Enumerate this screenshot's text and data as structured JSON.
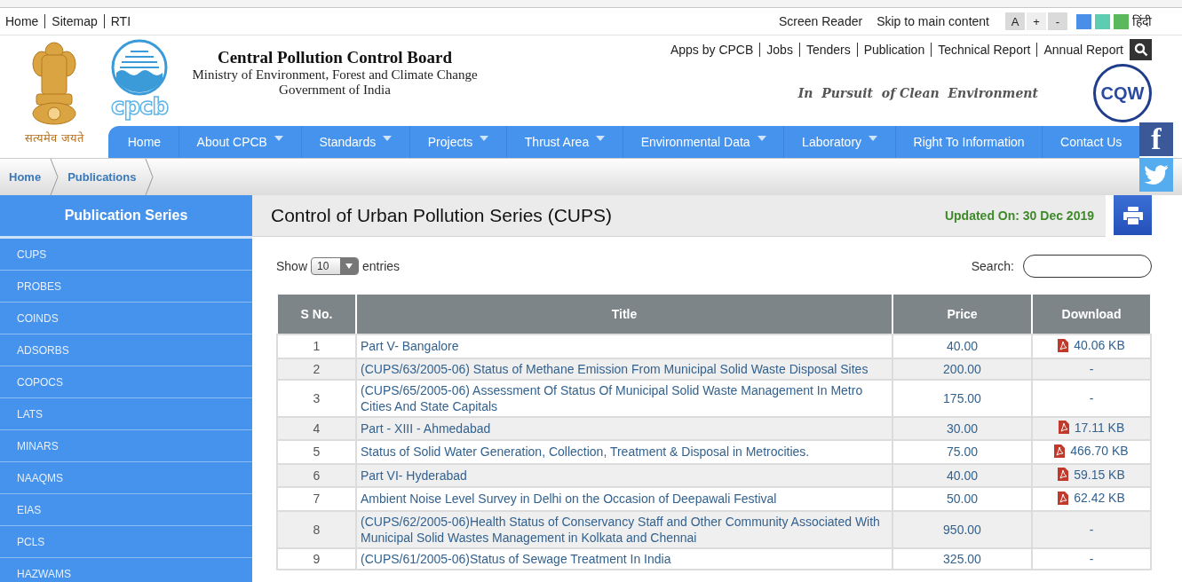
{
  "top_links": [
    {
      "label": "Home"
    },
    {
      "label": "Sitemap"
    },
    {
      "label": "RTI"
    }
  ],
  "accessibility": {
    "screen_reader": "Screen Reader",
    "skip": "Skip to main content",
    "font_buttons": [
      "A",
      "+",
      "-"
    ],
    "themes": [
      {
        "color": "#4a8fe7"
      },
      {
        "color": "#5ccdb0"
      },
      {
        "color": "#5cb85c"
      }
    ],
    "language": "हिंदी"
  },
  "header": {
    "emblem_motto": "सत्यमेव जयते",
    "logo_text": "cpcb",
    "title": "Central Pollution Control Board",
    "ministry": "Ministry of Environment, Forest and Climate Change",
    "government": "Government of India",
    "tagline": "In  Pursuit  of Clean  Environment",
    "badge_text": "CQW"
  },
  "quick_links": [
    "Apps by CPCB",
    "Jobs",
    "Tenders",
    "Publication",
    "Technical Report",
    "Annual Report"
  ],
  "nav": [
    {
      "label": "Home",
      "dropdown": false
    },
    {
      "label": "About CPCB",
      "dropdown": true
    },
    {
      "label": "Standards",
      "dropdown": true
    },
    {
      "label": "Projects",
      "dropdown": true
    },
    {
      "label": "Thrust Area",
      "dropdown": true
    },
    {
      "label": "Environmental Data",
      "dropdown": true
    },
    {
      "label": "Laboratory",
      "dropdown": true
    },
    {
      "label": "Right To Information",
      "dropdown": false
    },
    {
      "label": "Contact Us",
      "dropdown": false
    }
  ],
  "social": [
    {
      "kind": "facebook",
      "text": "f"
    },
    {
      "kind": "twitter"
    }
  ],
  "breadcrumb": [
    "Home",
    "Publications"
  ],
  "sidebar": {
    "title": "Publication Series",
    "items": [
      "CUPS",
      "PROBES",
      "COINDS",
      "ADSORBS",
      "COPOCS",
      "LATS",
      "MINARS",
      "NAAQMS",
      "EIAS",
      "PCLS",
      "HAZWAMS"
    ]
  },
  "page": {
    "title": "Control of Urban Pollution Series (CUPS)",
    "updated": "Updated On: 30 Dec 2019"
  },
  "table_controls": {
    "show_label": "Show",
    "page_size": "10",
    "entries_label": "entries",
    "search_label": "Search:"
  },
  "table": {
    "columns": [
      "S No.",
      "Title",
      "Price",
      "Download"
    ],
    "rows": [
      {
        "sno": "1",
        "title": "Part V- Bangalore",
        "price": "40.00",
        "download": {
          "kind": "pdf",
          "text": "40.06 KB"
        }
      },
      {
        "sno": "2",
        "title": "(CUPS/63/2005-06) Status of Methane Emission From Municipal Solid Waste Disposal Sites",
        "price": "200.00",
        "download": {
          "kind": "none",
          "text": "-"
        }
      },
      {
        "sno": "3",
        "title": "(CUPS/65/2005-06) Assessment Of Status Of Municipal Solid Waste Management In Metro Cities And State Capitals",
        "price": "175.00",
        "download": {
          "kind": "none",
          "text": "-"
        }
      },
      {
        "sno": "4",
        "title": "Part - XIII - Ahmedabad",
        "price": "30.00",
        "download": {
          "kind": "pdf",
          "text": "17.11 KB"
        }
      },
      {
        "sno": "5",
        "title": "Status of Solid Water Generation, Collection, Treatment & Disposal in Metrocities.",
        "price": "75.00",
        "download": {
          "kind": "pdf",
          "text": "466.70 KB"
        }
      },
      {
        "sno": "6",
        "title": "Part VI- Hyderabad",
        "price": "40.00",
        "download": {
          "kind": "pdf",
          "text": "59.15 KB"
        }
      },
      {
        "sno": "7",
        "title": "Ambient Noise Level Survey in Delhi on the Occasion of Deepawali Festival",
        "price": "50.00",
        "download": {
          "kind": "pdf",
          "text": "62.42 KB"
        }
      },
      {
        "sno": "8",
        "title": "(CUPS/62/2005-06)Health Status of Conservancy Staff and Other Community Associated With Municipal Solid Wastes Management in Kolkata and Chennai",
        "price": "950.00",
        "download": {
          "kind": "none",
          "text": "-"
        }
      },
      {
        "sno": "9",
        "title": "(CUPS/61/2005-06)Status of Sewage Treatment In India",
        "price": "325.00",
        "download": {
          "kind": "none",
          "text": "-"
        }
      }
    ]
  }
}
